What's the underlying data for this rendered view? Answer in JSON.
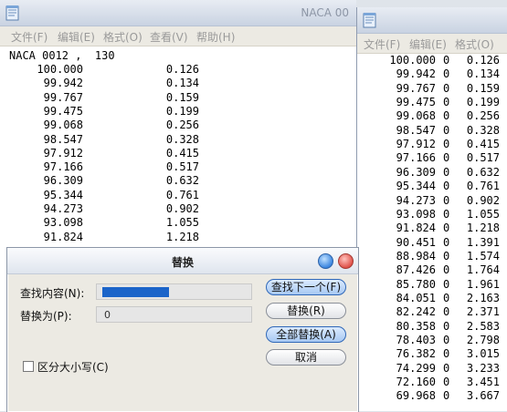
{
  "left_window": {
    "title": "NACA 00",
    "menu": [
      "文件(F)",
      "编辑(E)",
      "格式(O)",
      "查看(V)",
      "帮助(H)"
    ],
    "header": "NACA 0012 ,  130",
    "rows": [
      {
        "x": "100.000",
        "y": "0.126"
      },
      {
        "x": "99.942",
        "y": "0.134"
      },
      {
        "x": "99.767",
        "y": "0.159"
      },
      {
        "x": "99.475",
        "y": "0.199"
      },
      {
        "x": "99.068",
        "y": "0.256"
      },
      {
        "x": "98.547",
        "y": "0.328"
      },
      {
        "x": "97.912",
        "y": "0.415"
      },
      {
        "x": "97.166",
        "y": "0.517"
      },
      {
        "x": "96.309",
        "y": "0.632"
      },
      {
        "x": "95.344",
        "y": "0.761"
      },
      {
        "x": "94.273",
        "y": "0.902"
      },
      {
        "x": "93.098",
        "y": "1.055"
      },
      {
        "x": "91.824",
        "y": "1.218"
      }
    ]
  },
  "right_window": {
    "menu": [
      "文件(F)",
      "编辑(E)",
      "格式(O)"
    ],
    "rows": [
      {
        "x": "100.000",
        "z": "0",
        "y": "0.126"
      },
      {
        "x": "99.942",
        "z": "0",
        "y": "0.134"
      },
      {
        "x": "99.767",
        "z": "0",
        "y": "0.159"
      },
      {
        "x": "99.475",
        "z": "0",
        "y": "0.199"
      },
      {
        "x": "99.068",
        "z": "0",
        "y": "0.256"
      },
      {
        "x": "98.547",
        "z": "0",
        "y": "0.328"
      },
      {
        "x": "97.912",
        "z": "0",
        "y": "0.415"
      },
      {
        "x": "97.166",
        "z": "0",
        "y": "0.517"
      },
      {
        "x": "96.309",
        "z": "0",
        "y": "0.632"
      },
      {
        "x": "95.344",
        "z": "0",
        "y": "0.761"
      },
      {
        "x": "94.273",
        "z": "0",
        "y": "0.902"
      },
      {
        "x": "93.098",
        "z": "0",
        "y": "1.055"
      },
      {
        "x": "91.824",
        "z": "0",
        "y": "1.218"
      },
      {
        "x": "90.451",
        "z": "0",
        "y": "1.391"
      },
      {
        "x": "88.984",
        "z": "0",
        "y": "1.574"
      },
      {
        "x": "87.426",
        "z": "0",
        "y": "1.764"
      },
      {
        "x": "85.780",
        "z": "0",
        "y": "1.961"
      },
      {
        "x": "84.051",
        "z": "0",
        "y": "2.163"
      },
      {
        "x": "82.242",
        "z": "0",
        "y": "2.371"
      },
      {
        "x": "80.358",
        "z": "0",
        "y": "2.583"
      },
      {
        "x": "78.403",
        "z": "0",
        "y": "2.798"
      },
      {
        "x": "76.382",
        "z": "0",
        "y": "3.015"
      },
      {
        "x": "74.299",
        "z": "0",
        "y": "3.233"
      },
      {
        "x": "72.160",
        "z": "0",
        "y": "3.451"
      },
      {
        "x": "69.968",
        "z": "0",
        "y": "3.667"
      }
    ]
  },
  "dialog": {
    "title": "替换",
    "find_label": "查找内容(N):",
    "replace_label": "替换为(P):",
    "replace_value": "0",
    "match_case_label": "区分大小写(C)",
    "buttons": {
      "find_next": "查找下一个(F)",
      "replace": "替换(R)",
      "replace_all": "全部替换(A)",
      "cancel": "取消"
    }
  },
  "colors": {
    "selection": "#1b64c9",
    "minimize": "#3b86e0",
    "close": "#e0524a"
  }
}
